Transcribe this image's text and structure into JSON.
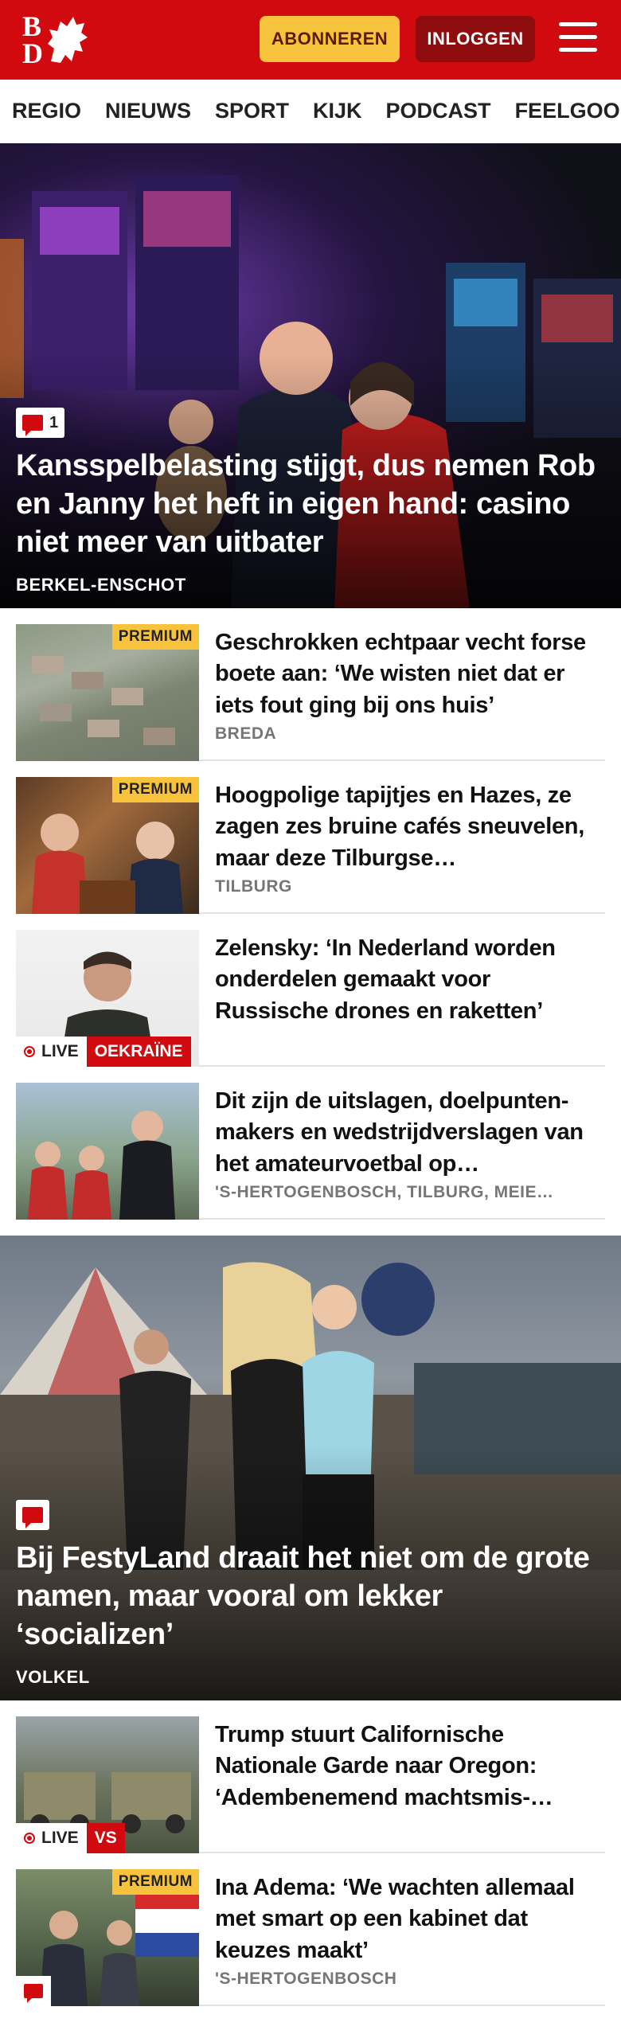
{
  "header": {
    "logo_top": "B",
    "logo_bottom": "D",
    "subscribe_label": "ABONNEREN",
    "login_label": "INLOGGEN",
    "brand_color": "#d10a10",
    "subscribe_color": "#f7c33d"
  },
  "nav": {
    "items": [
      {
        "label": "REGIO"
      },
      {
        "label": "NIEUWS"
      },
      {
        "label": "SPORT"
      },
      {
        "label": "KIJK"
      },
      {
        "label": "PODCAST"
      },
      {
        "label": "FEELGOOD"
      }
    ]
  },
  "hero1": {
    "comment_count": "1",
    "title": "Kansspelbelasting stijgt, dus nemen Rob en Janny het heft in eigen hand: casino niet meer van uitbater",
    "location": "BERKEL-ENSCHOT"
  },
  "articles1": [
    {
      "title": "Geschrokken echtpaar vecht forse boete aan: ‘We wisten niet dat er iets fout ging bij ons huis’",
      "location": "BREDA",
      "premium": "PREMIUM"
    },
    {
      "title": "Hoogpolige tapijtjes en Hazes, ze zagen zes bruine cafés sneuvelen, maar deze Tilburgse…",
      "location": "TILBURG",
      "premium": "PREMIUM"
    },
    {
      "title": "Zelensky: ‘In Nederland worden onderdelen gemaakt voor Russische drones en raketten’",
      "live": "LIVE",
      "tag": "OEKRAÏNE"
    },
    {
      "title": "Dit zijn de uitslagen, doelpunten­makers en wedstrijdverslagen van het amateurvoetbal op…",
      "location": "'S-HERTOGENBOSCH, TILBURG, MEIE…"
    }
  ],
  "hero2": {
    "title": "Bij FestyLand draait het niet om de grote namen, maar vooral om lekker ‘socializen’",
    "location": "VOLKEL"
  },
  "articles2": [
    {
      "title": "Trump stuurt Californische Nationale Garde naar Oregon: ‘Adembenemend machtsmis-…",
      "live": "LIVE",
      "tag": "VS"
    },
    {
      "title": "Ina Adema: ‘We wachten allemaal met smart op een kabinet dat keuzes maakt’",
      "location": "'S-HERTOGENBOSCH",
      "premium": "PREMIUM"
    }
  ]
}
